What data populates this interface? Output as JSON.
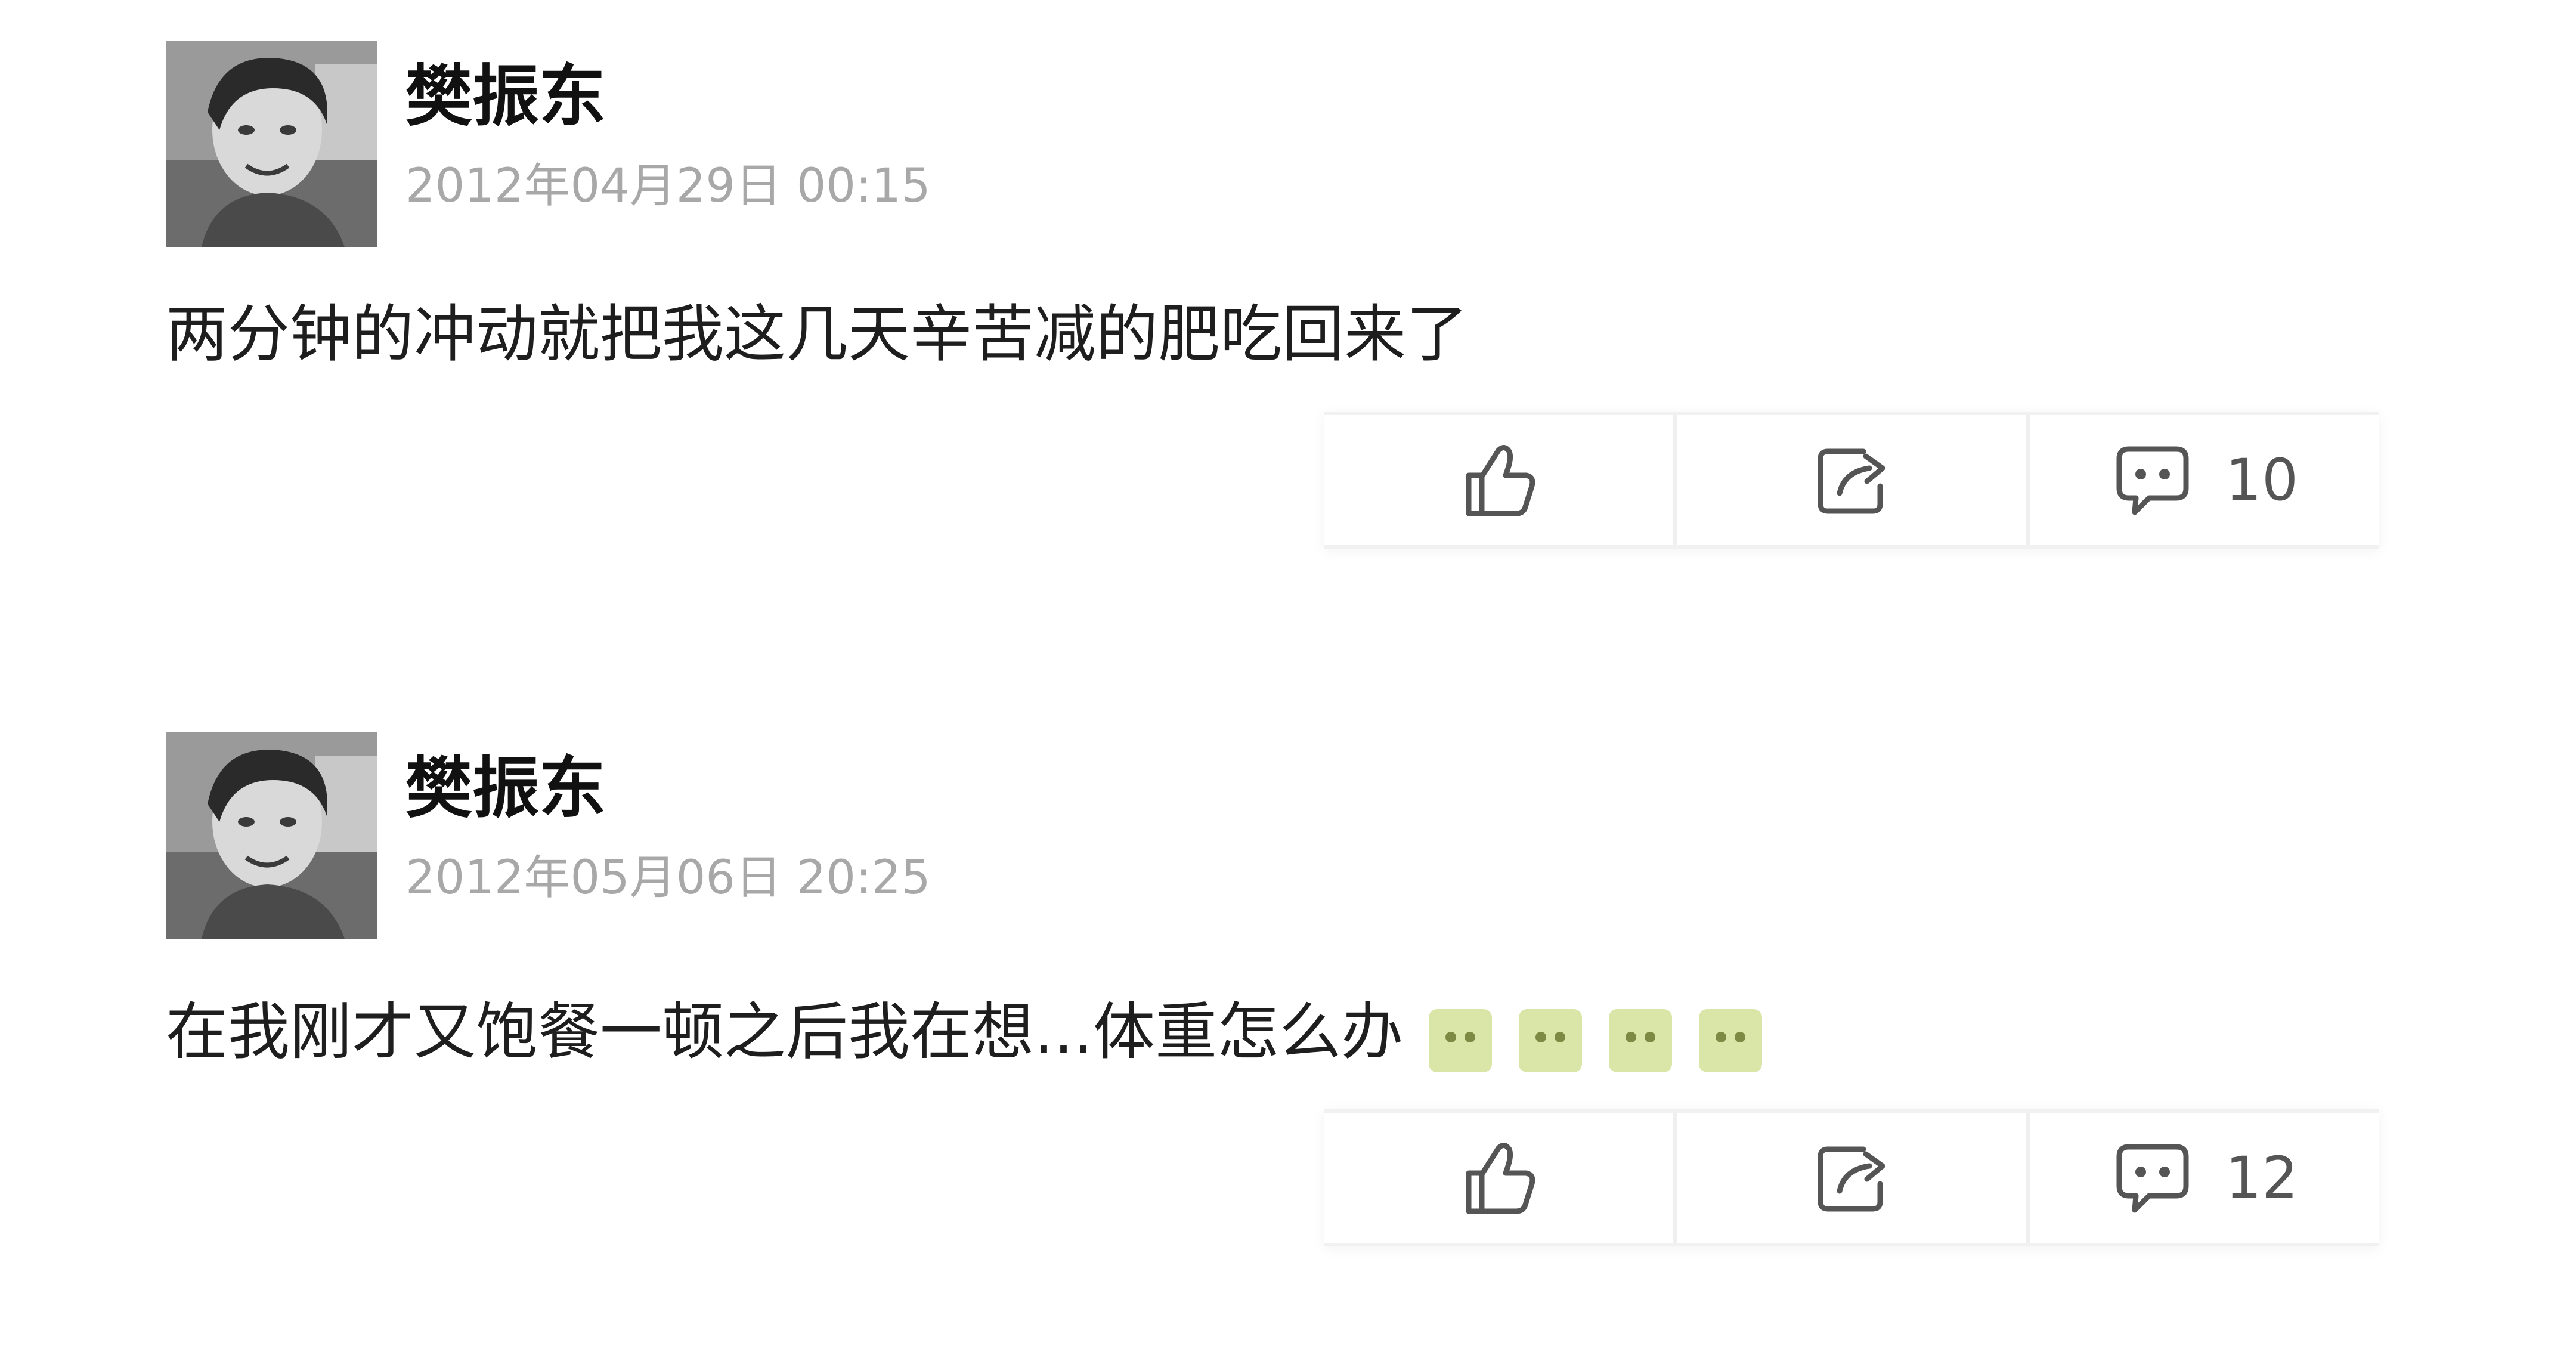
{
  "posts": [
    {
      "author": "樊振东",
      "time": "2012年04月29日 00:15",
      "text": "两分钟的冲动就把我这几天辛苦减的肥吃回来了",
      "emoji_count": 0,
      "actions": {
        "like_icon": "thumbs-up-icon",
        "share_icon": "share-icon",
        "comment_icon": "comment-icon",
        "comment_count": "10"
      }
    },
    {
      "author": "樊振东",
      "time": "2012年05月06日 20:25",
      "text": "在我刚才又饱餐一顿之后我在想...体重怎么办",
      "emoji_count": 4,
      "emoji_name": "sweat-emoji",
      "actions": {
        "like_icon": "thumbs-up-icon",
        "share_icon": "share-icon",
        "comment_icon": "comment-icon",
        "comment_count": "12"
      }
    }
  ],
  "colors": {
    "text": "#1e1e1e",
    "timestamp": "#a8a8a8",
    "emoji_bg": "#d9e6a8",
    "icon_stroke": "#555555"
  }
}
